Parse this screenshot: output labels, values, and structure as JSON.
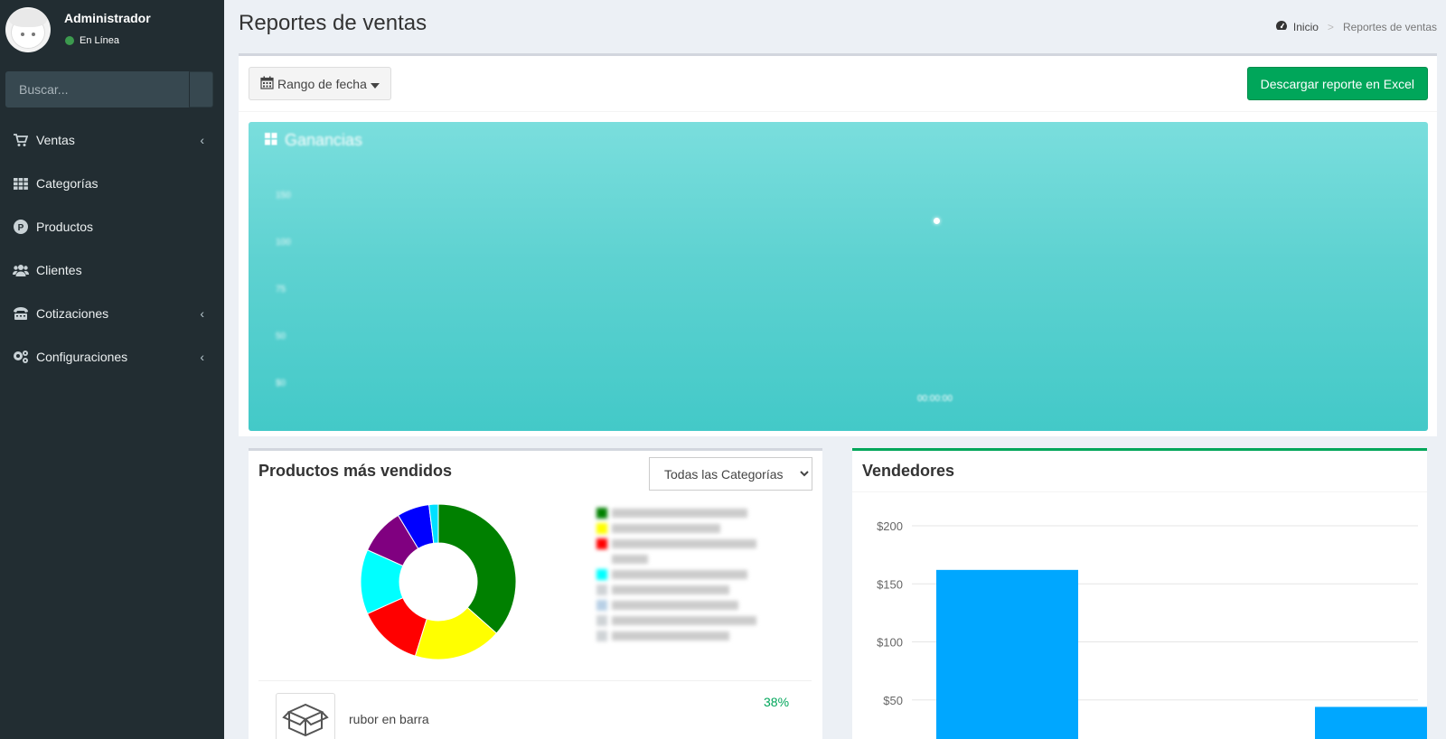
{
  "sidebar": {
    "user": {
      "name": "Administrador",
      "status": "En Línea"
    },
    "search": {
      "placeholder": "Buscar..."
    },
    "menu": [
      {
        "label": "Ventas",
        "icon": "cart-icon",
        "has_submenu": true
      },
      {
        "label": "Categorías",
        "icon": "grid-icon",
        "has_submenu": false
      },
      {
        "label": "Productos",
        "icon": "product-p-icon",
        "has_submenu": false
      },
      {
        "label": "Clientes",
        "icon": "users-icon",
        "has_submenu": false
      },
      {
        "label": "Cotizaciones",
        "icon": "fax-icon",
        "has_submenu": true
      },
      {
        "label": "Configuraciones",
        "icon": "gears-icon",
        "has_submenu": true
      }
    ]
  },
  "header": {
    "title": "Reportes de ventas",
    "breadcrumb": {
      "home": "Inicio",
      "current": "Reportes de ventas"
    }
  },
  "toolbar": {
    "daterange_label": "Rango de fecha",
    "excel_label": "Descargar reporte en Excel"
  },
  "earnings": {
    "title": "Ganancias",
    "y_ticks": [
      "150",
      "100",
      "75",
      "50",
      "$0"
    ],
    "x_tick": "00:00:00",
    "colors": {
      "top": "#7adedd",
      "bottom": "#43c9c8"
    }
  },
  "products": {
    "title": "Productos más vendidos",
    "category_select": {
      "selected": "Todas las Categorías",
      "options": [
        "Todas las Categorías"
      ]
    },
    "top_item": {
      "name": "rubor en barra",
      "percent": "38%"
    },
    "chart_data": {
      "type": "pie",
      "values": [
        38,
        19,
        14,
        14,
        10,
        7,
        2
      ],
      "colors": [
        "#008000",
        "#ffff00",
        "#ff0000",
        "#00ffff",
        "#800080",
        "#0000ff",
        "#00e0ff"
      ]
    }
  },
  "sellers": {
    "title": "Vendedores",
    "chart_data": {
      "type": "bar",
      "values": [
        162,
        44
      ],
      "y_ticks": [
        "$200",
        "$150",
        "$100",
        "$50"
      ],
      "ylim": [
        0,
        200
      ],
      "color": "#00a7ff"
    }
  }
}
